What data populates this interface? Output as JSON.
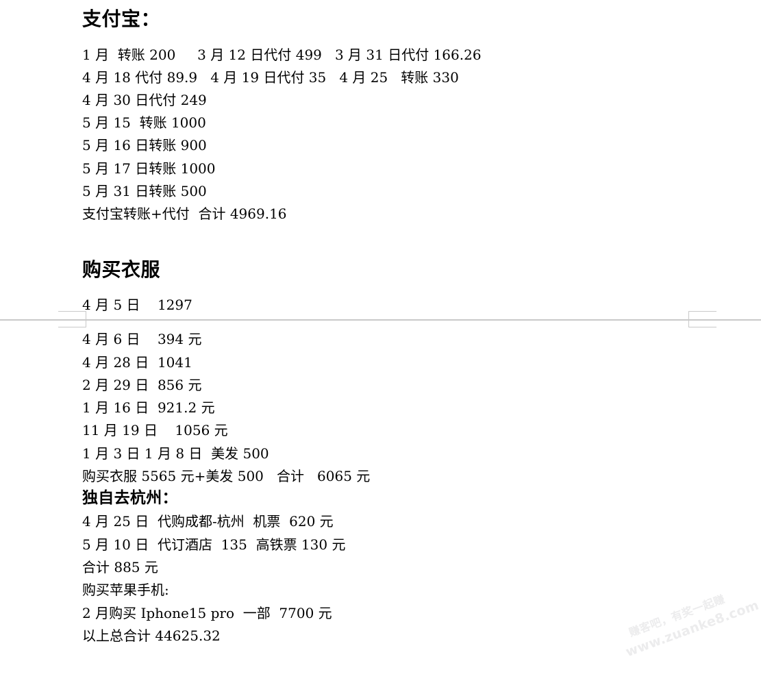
{
  "document": {
    "background_color": "#ffffff",
    "text_color": "#000000",
    "page_break": {
      "rule_color": "#c9c9c9",
      "label": "page-break-separator"
    },
    "watermark": {
      "line1": "赚客吧，有奖一起赚",
      "line2": "www.zuanke8.com",
      "color": "#ececed"
    },
    "sections": [
      {
        "id": "alipay",
        "heading": "支付宝：",
        "heading_level": "major",
        "lines": [
          "1 月  转账 200     3 月 12 日代付 499   3 月 31 日代付 166.26",
          "4 月 18 代付 89.9   4 月 19 日代付 35   4 月 25   转账 330",
          "4 月 30 日代付 249",
          "5 月 15  转账 1000",
          "5 月 16 日转账 900",
          "5 月 17 日转账 1000",
          "5 月 31 日转账 500",
          "支付宝转账+代付  合计 4969.16"
        ],
        "total_label": "支付宝转账+代付  合计",
        "total_value": "4969.16"
      },
      {
        "id": "clothing",
        "heading": "购买衣服",
        "heading_level": "major",
        "lines": [
          "4 月 5 日    1297",
          "4 月 6 日    394 元",
          "4 月 28 日  1041",
          "2 月 29 日  856 元",
          "1 月 16 日  921.2 元",
          "11 月 19 日    1056 元",
          "1 月 3 日 1 月 8 日  美发 500",
          "购买衣服 5565 元+美发 500   合计   6065 元"
        ],
        "total_label": "购买衣服 5565 元+美发 500   合计",
        "total_value": "6065 元"
      },
      {
        "id": "hangzhou",
        "heading": "独自去杭州：",
        "heading_level": "minor",
        "lines": [
          "4 月 25 日  代购成都-杭州  机票  620 元",
          "5 月 10 日  代订酒店  135  高铁票 130 元",
          "合计 885 元"
        ],
        "total_label": "合计",
        "total_value": "885 元"
      },
      {
        "id": "iphone",
        "heading": "购买苹果手机:",
        "heading_level": "body",
        "lines": [
          "2 月购买 Iphone15 pro  一部  7700 元"
        ]
      }
    ],
    "grand_total_line": "以上总合计 44625.32",
    "grand_total_label": "以上总合计",
    "grand_total_value": "44625.32"
  }
}
